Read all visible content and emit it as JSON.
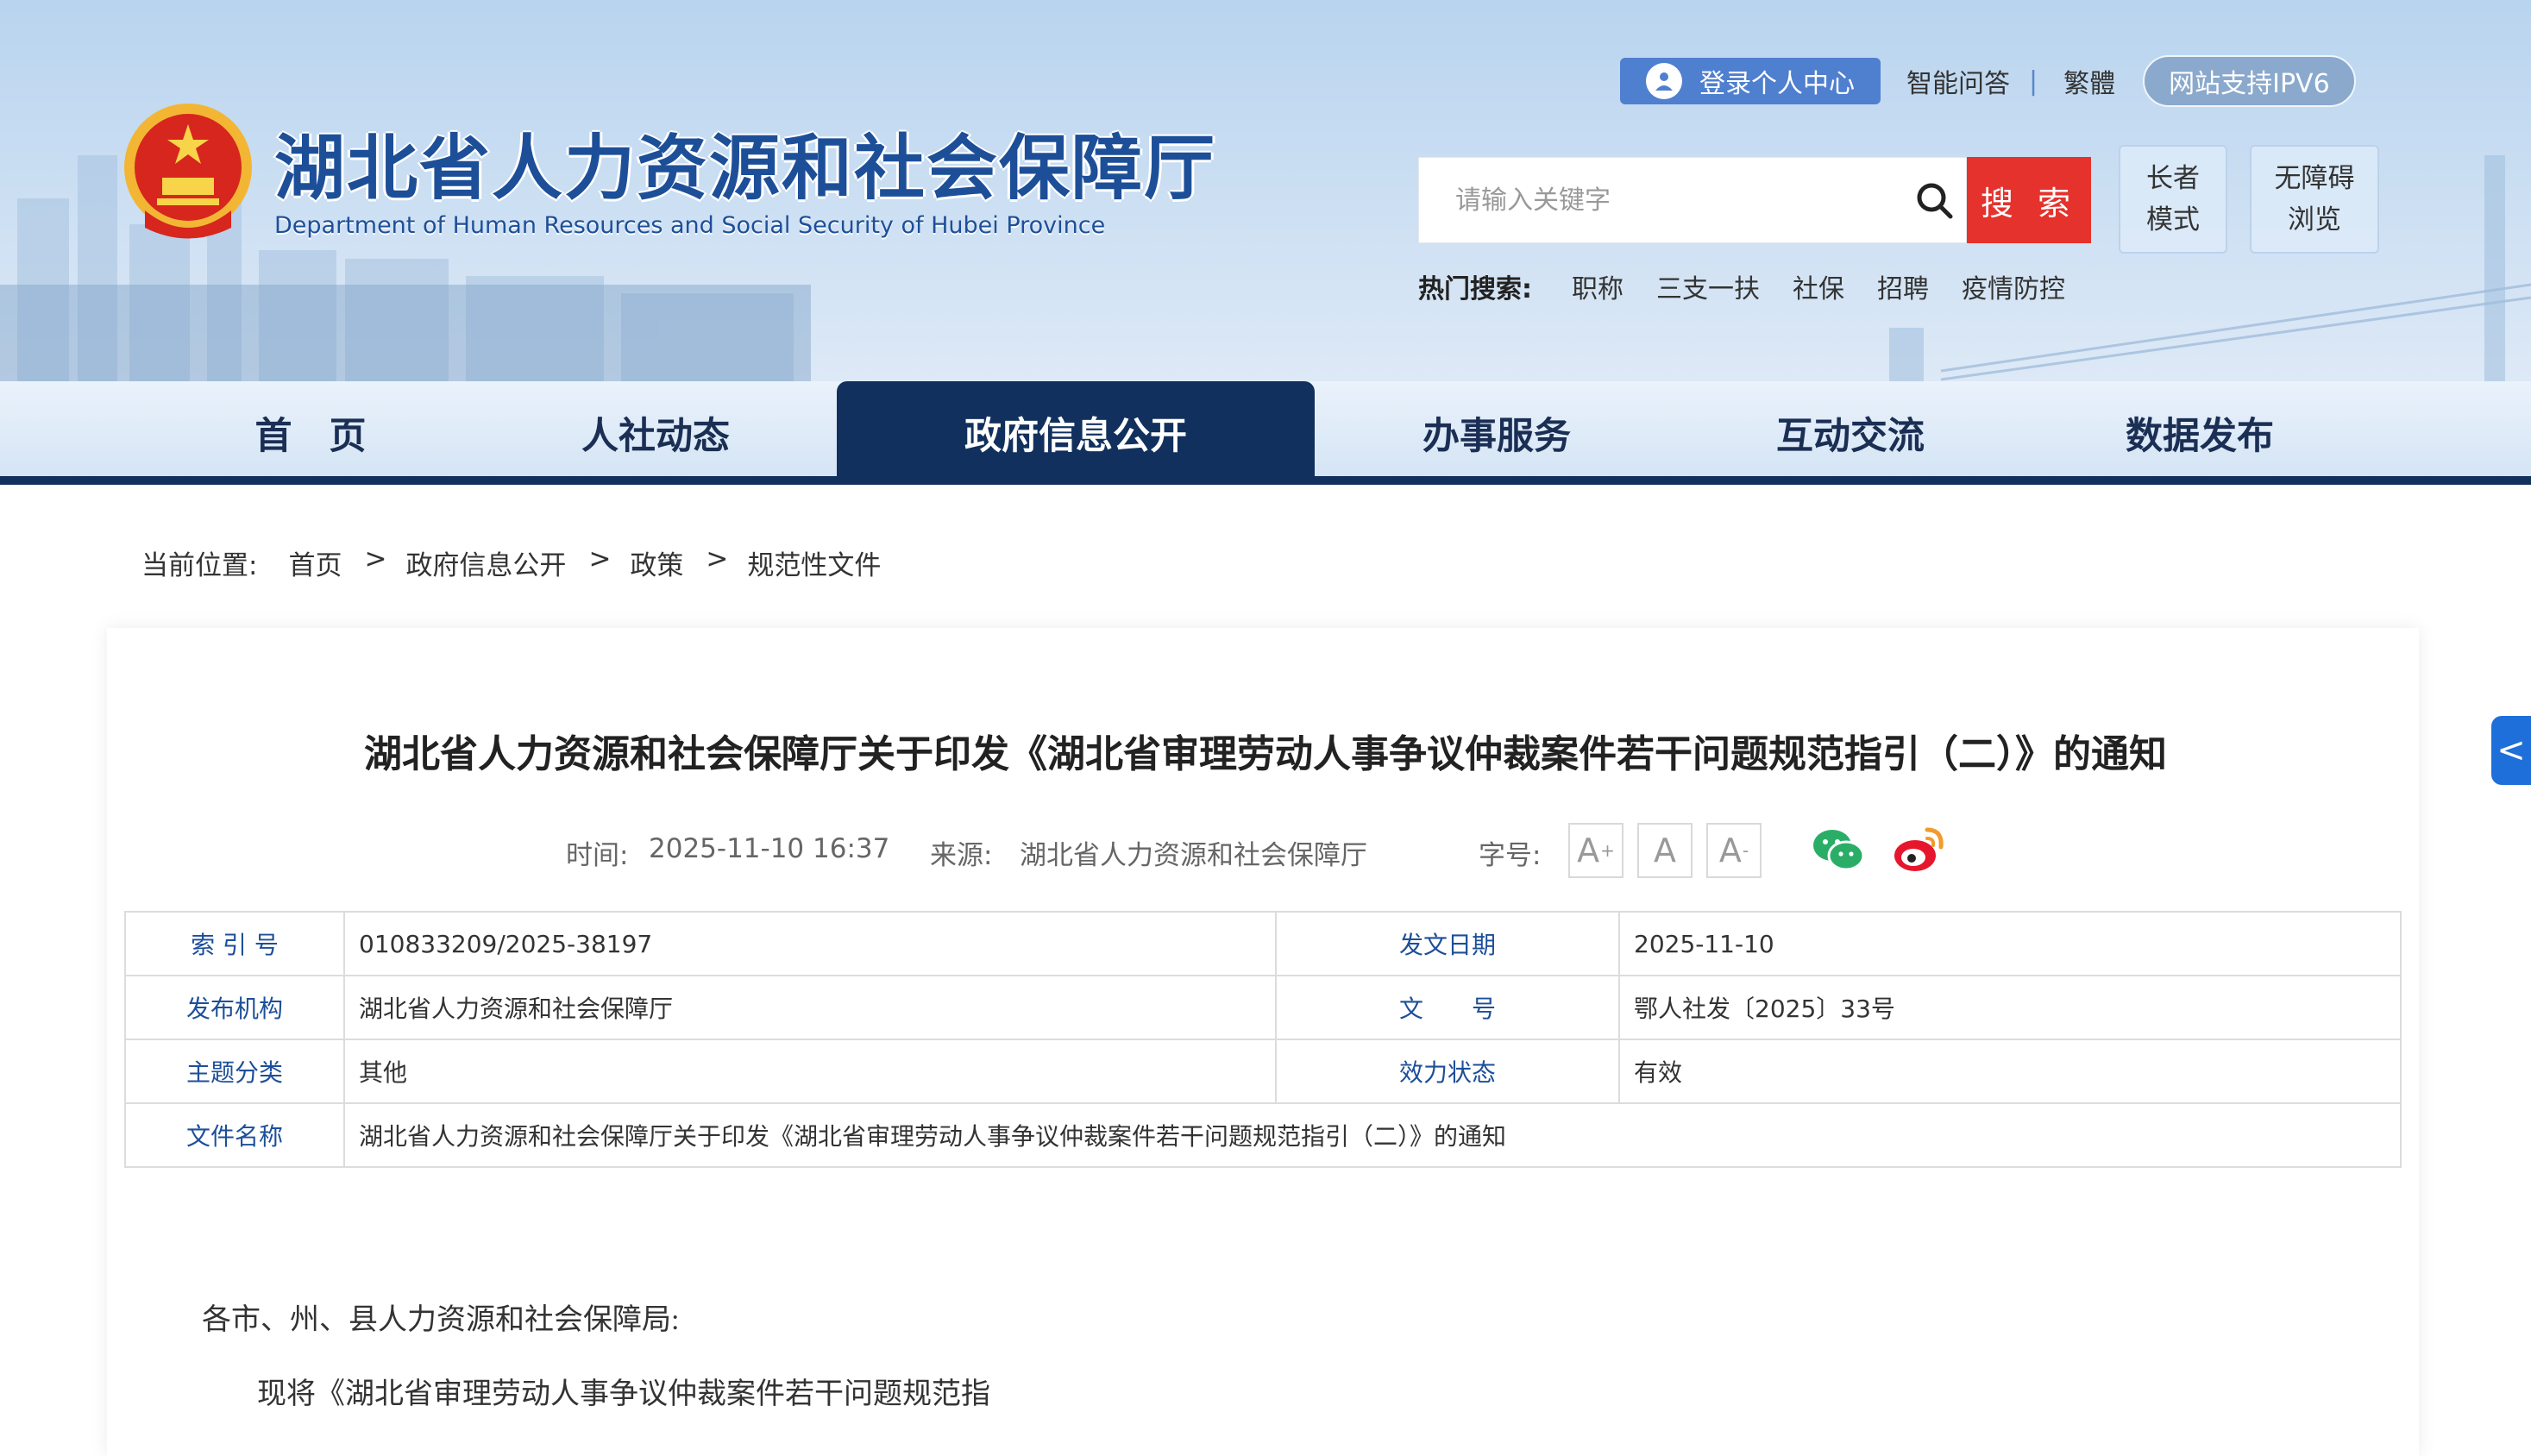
{
  "header": {
    "site_title": "湖北省人力资源和社会保障厅",
    "site_subtitle": "Department of Human Resources and Social Security of Hubei Province",
    "login_label": "登录个人中心",
    "smart_qa_label": "智能问答",
    "separator": "|",
    "traditional_label": "繁體",
    "ipv6_label": "网站支持IPV6",
    "search_placeholder": "请输入关键字",
    "search_button": "搜 索",
    "elder_mode_line1": "长者",
    "elder_mode_line2": "模式",
    "access_line1": "无障碍",
    "access_line2": "浏览",
    "hot_search_label": "热门搜索:",
    "hot_search_items": [
      "职称",
      "三支一扶",
      "社保",
      "招聘",
      "疫情防控"
    ]
  },
  "nav": {
    "items": [
      "首　页",
      "人社动态",
      "政府信息公开",
      "办事服务",
      "互动交流",
      "数据发布"
    ],
    "active_index": 2
  },
  "breadcrumb": {
    "label": "当前位置:",
    "items": [
      "首页",
      "政府信息公开",
      "政策",
      "规范性文件"
    ],
    "separator": ">"
  },
  "article": {
    "title": "湖北省人力资源和社会保障厅关于印发《湖北省审理劳动人事争议仲裁案件若干问题规范指引（二）》的通知",
    "time_label": "时间:",
    "time_value": "2025-11-10 16:37",
    "source_label": "来源:",
    "source_value": "湖北省人力资源和社会保障厅",
    "font_size_label": "字号:",
    "font_buttons": [
      "A",
      "A",
      "A"
    ],
    "font_button_marks": [
      "+",
      "",
      "-"
    ],
    "info": {
      "index_label": "索 引 号",
      "index_value": "010833209/2025-38197",
      "date_label": "发文日期",
      "date_value": "2025-11-10",
      "issuer_label": "发布机构",
      "issuer_value": "湖北省人力资源和社会保障厅",
      "doc_no_label": "文　　号",
      "doc_no_value": "鄂人社发〔2025〕33号",
      "topic_label": "主题分类",
      "topic_value": "其他",
      "status_label": "效力状态",
      "status_value": "有效",
      "name_label": "文件名称",
      "name_value": "湖北省人力资源和社会保障厅关于印发《湖北省审理劳动人事争议仲裁案件若干问题规范指引（二）》的通知"
    },
    "body_line1": "各市、州、县人力资源和社会保障局:",
    "body_line2": "现将《湖北省审理劳动人事争议仲裁案件若干问题规范指"
  },
  "side_tab_label": "<",
  "colors": {
    "brand_blue": "#1d4f99",
    "nav_dark": "#11305d",
    "search_red": "#e5322d",
    "wechat_green": "#2aae67",
    "weibo_orange": "#f29b2c",
    "weibo_red": "#e6162d"
  },
  "icons": [
    "emblem-icon",
    "user-icon",
    "search-icon",
    "wechat-icon",
    "weibo-icon"
  ]
}
